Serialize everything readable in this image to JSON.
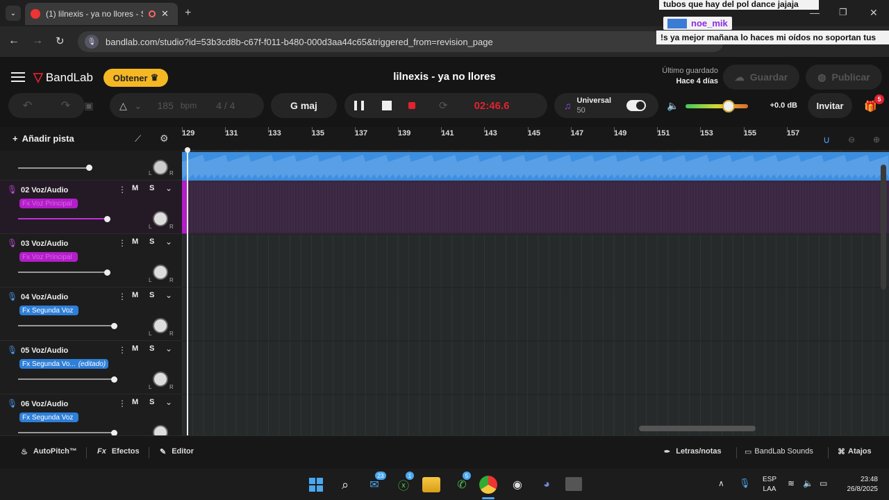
{
  "browser": {
    "tab_title": "(1) lilnexis - ya no llores - S",
    "url": "bandlab.com/studio?id=53b3cd8b-c67f-f011-b480-000d3aa44c65&triggered_from=revision_page"
  },
  "chat_overlay": {
    "line1": "tubos que hay del pol dance jajaja",
    "user": "noe_mik",
    "line2": "!s ya mejor mañana lo haces mi oídos no soportan tus"
  },
  "header": {
    "logo": "BandLab",
    "upgrade_label": "Obtener",
    "project_title": "lilnexis - ya no llores",
    "last_saved_label": "Último guardado",
    "last_saved_value": "Hace 4 días",
    "save_label": "Guardar",
    "publish_label": "Publicar"
  },
  "toolbar": {
    "bpm_value": "185",
    "bpm_unit": "bpm",
    "time_signature": "4 / 4",
    "key": "G maj",
    "time": "02:46.6",
    "universal_label": "Universal",
    "universal_value": "50",
    "volume_db": "+0.0 dB",
    "invite_label": "Invitar",
    "gift_badge": "5",
    "master_volume_level": 0.69
  },
  "arrange": {
    "add_track_label": "Añadir pista",
    "bar_numbers": [
      "129",
      "131",
      "133",
      "135",
      "137",
      "139",
      "141",
      "143",
      "145",
      "147",
      "149",
      "151",
      "153",
      "155",
      "157"
    ]
  },
  "tracks": [
    {
      "name": "02 Voz/Audio",
      "fx": "Fx Voz Principal",
      "fx_color": "#b21ec8",
      "mic_color": "#c04cd8",
      "volume": 0.93
    },
    {
      "name": "03 Voz/Audio",
      "fx": "Fx Voz Principal",
      "fx_color": "#b21ec8",
      "mic_color": "#c04cd8",
      "volume": 0.93
    },
    {
      "name": "04 Voz/Audio",
      "fx": "Fx Segunda Voz",
      "fx_color": "#2e7fd8",
      "mic_color": "#4a9cf2",
      "volume": 1.0
    },
    {
      "name": "05 Voz/Audio",
      "fx": "Fx Segunda Vo...",
      "fx_extra": "(editado)",
      "fx_color": "#2e7fd8",
      "mic_color": "#4a9cf2",
      "volume": 1.0
    },
    {
      "name": "06 Voz/Audio",
      "fx": "Fx Segunda Voz",
      "fx_color": "#2e7fd8",
      "mic_color": "#4a9cf2",
      "volume": 1.0
    }
  ],
  "track_buttons": {
    "mute": "M",
    "solo": "S",
    "pan_left": "L",
    "pan_right": "R"
  },
  "bottom_bar": {
    "autopitch": "AutoPitch™",
    "effects": "Efectos",
    "editor": "Editor",
    "lyrics": "Letras/notas",
    "sounds": "BandLab Sounds",
    "shortcuts": "Atajos"
  },
  "taskbar": {
    "lang": "ESP",
    "layout": "LAA",
    "time": "23:48",
    "date": "26/8/2025",
    "badge_mail": "23",
    "badge_xbox": "1",
    "badge_whatsapp": "5"
  },
  "colors": {
    "accent_orange": "#f5a623",
    "record_red": "#e0232e",
    "track_purple": "#b21ec8",
    "track_blue": "#2e7fd8",
    "waveform_blue": "#3c8fe0"
  }
}
